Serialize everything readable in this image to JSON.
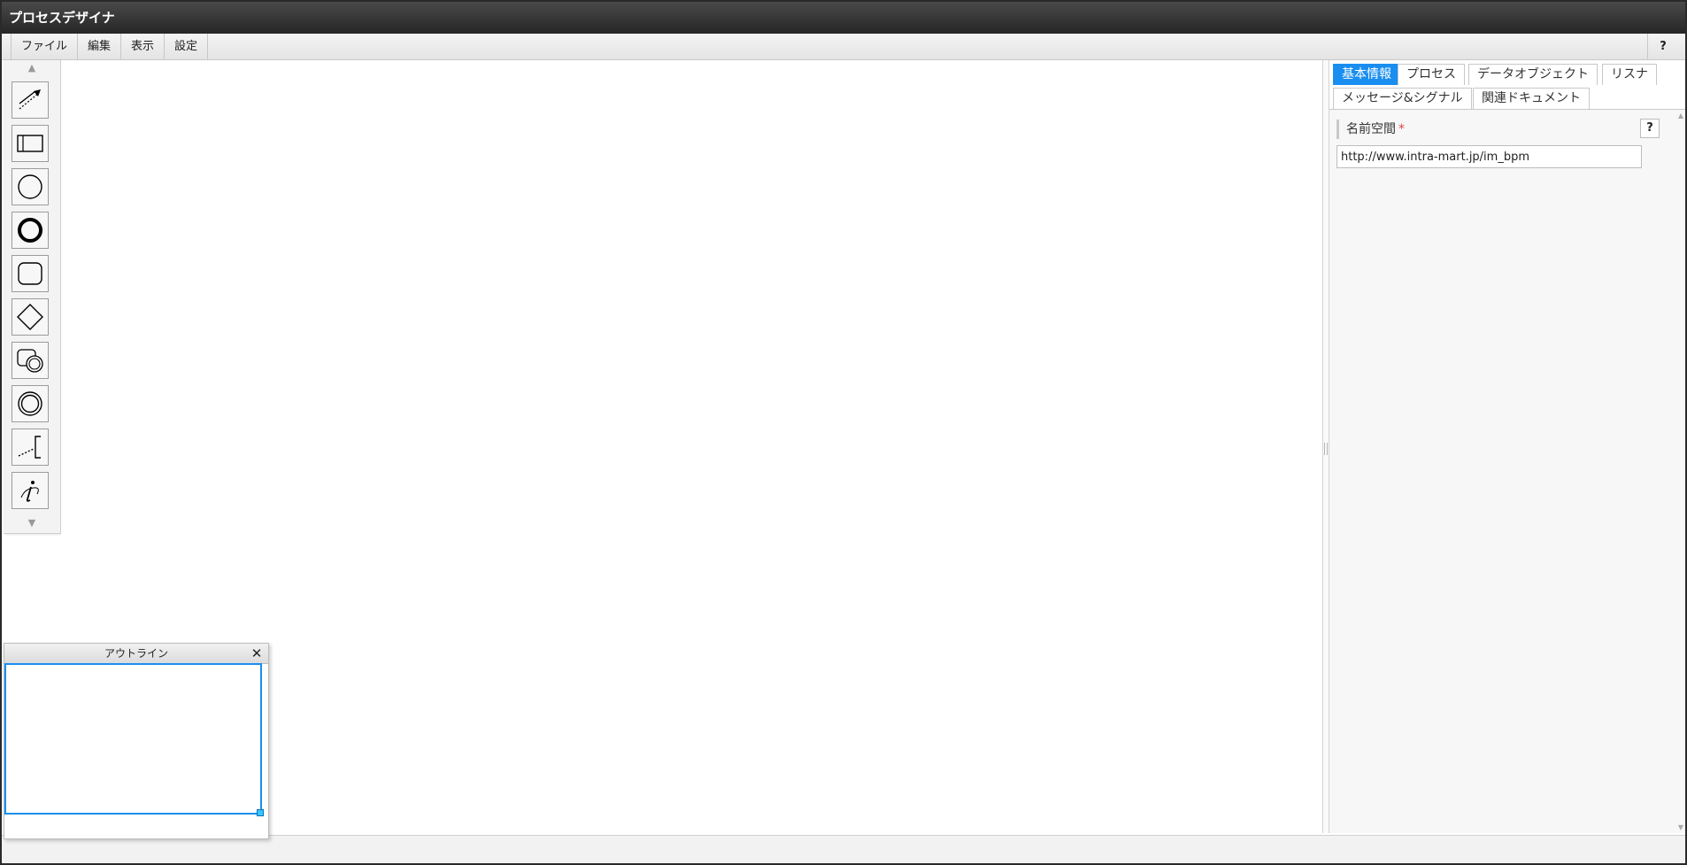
{
  "app": {
    "title": "プロセスデザイナ"
  },
  "menu": {
    "items": [
      {
        "label": "ファイル"
      },
      {
        "label": "編集"
      },
      {
        "label": "表示"
      },
      {
        "label": "設定"
      }
    ],
    "help_label": "?"
  },
  "palette": {
    "scroll_up": "▲",
    "scroll_down": "▼",
    "tools": [
      {
        "icon": "sequence-flow-icon"
      },
      {
        "icon": "pool-lane-icon"
      },
      {
        "icon": "start-event-icon"
      },
      {
        "icon": "end-event-icon"
      },
      {
        "icon": "task-icon"
      },
      {
        "icon": "gateway-icon"
      },
      {
        "icon": "subprocess-icon"
      },
      {
        "icon": "intermediate-event-icon"
      },
      {
        "icon": "annotation-icon"
      },
      {
        "icon": "info-icon"
      }
    ]
  },
  "properties": {
    "tabs": [
      {
        "label": "基本情報",
        "active": true
      },
      {
        "label": "プロセス"
      },
      {
        "label": "データオブジェクト"
      },
      {
        "label": "リスナ"
      },
      {
        "label": "メッセージ&シグナル"
      },
      {
        "label": "関連ドキュメント"
      }
    ],
    "namespace": {
      "label": "名前空間",
      "required_mark": "*",
      "help": "?",
      "value": "http://www.intra-mart.jp/im_bpm"
    }
  },
  "outline": {
    "title": "アウトライン",
    "close": "✕"
  },
  "colors": {
    "accent": "#1a8ef0",
    "titlebar": "#2e2e2e",
    "required": "#e04040"
  }
}
